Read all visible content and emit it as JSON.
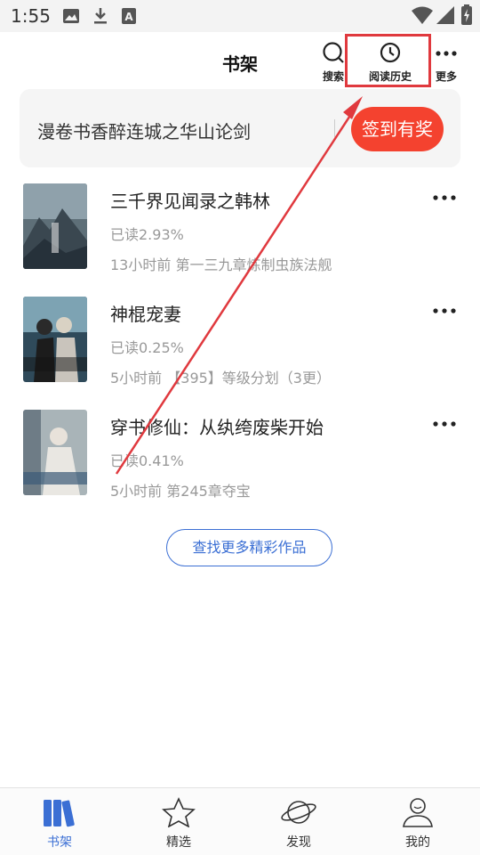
{
  "status_bar": {
    "time": "1:55",
    "left_icons": [
      "image-icon",
      "download-icon",
      "text-a-icon"
    ],
    "right_icons": [
      "wifi-icon",
      "signal-icon",
      "battery-charging-icon"
    ]
  },
  "header": {
    "title": "书架",
    "search_label": "搜索",
    "history_label": "阅读历史",
    "more_label": "更多",
    "highlight_color": "#e0393e"
  },
  "banner": {
    "text": "漫卷书香醉连城之华山论剑",
    "checkin_label": "签到有奖",
    "checkin_color": "#f4422f"
  },
  "books": [
    {
      "title": "三千界见闻录之韩林",
      "progress": "已读2.93%",
      "update": "13小时前 第一三九章炼制虫族法舰",
      "cover_icon": "mountain-cover-art"
    },
    {
      "title": "神棍宠妻",
      "progress": "已读0.25%",
      "update": "5小时前 【395】等级分划（3更）",
      "cover_icon": "couple-cover-art"
    },
    {
      "title": "穿书修仙：从纨绔废柴开始",
      "progress": "已读0.41%",
      "update": "5小时前 第245章夺宝",
      "cover_icon": "immortal-cover-art"
    }
  ],
  "find_more_label": "查找更多精彩作品",
  "accent_color": "#3b6fd4",
  "bottom_nav": [
    {
      "label": "书架",
      "icon": "bookshelf-icon",
      "active": true
    },
    {
      "label": "精选",
      "icon": "star-icon",
      "active": false
    },
    {
      "label": "发现",
      "icon": "planet-icon",
      "active": false
    },
    {
      "label": "我的",
      "icon": "profile-icon",
      "active": false
    }
  ]
}
